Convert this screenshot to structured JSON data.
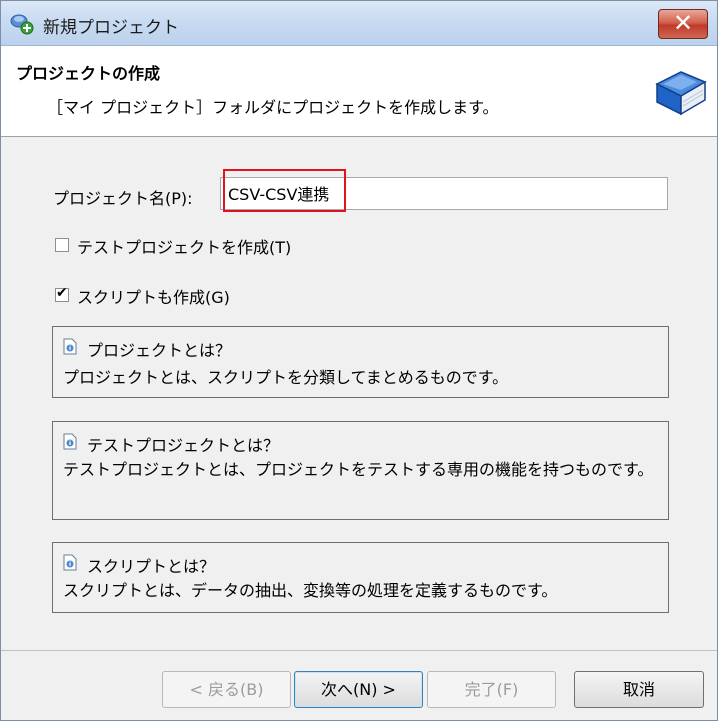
{
  "window": {
    "title": "新規プロジェクト",
    "close_glyph": "✕"
  },
  "header": {
    "title": "プロジェクトの作成",
    "description": "［マイ プロジェクト］フォルダにプロジェクトを作成します。",
    "icon": "book-icon",
    "icon_color": "#1f63c6"
  },
  "form": {
    "project_name_label": "プロジェクト名(P):",
    "project_name_value": "CSV-CSV連携",
    "highlight_color": "#e0141e",
    "test_project_checkbox": {
      "label": "テストプロジェクトを作成(T)",
      "checked": false
    },
    "script_checkbox": {
      "label": "スクリプトも作成(G)",
      "checked": true,
      "mark": "✔"
    }
  },
  "info_boxes": [
    {
      "title": "プロジェクトとは？",
      "body": "プロジェクトとは、スクリプトを分類してまとめるものです。"
    },
    {
      "title": "テストプロジェクトとは？",
      "body": "テストプロジェクトとは、プロジェクトをテストする専用の機能を持つものです。"
    },
    {
      "title": "スクリプトとは？",
      "body": "スクリプトとは、データの抽出、変換等の処理を定義するものです。"
    }
  ],
  "footer": {
    "back_label": "< 戻る(B)",
    "next_label": "次へ(N) >",
    "finish_label": "完了(F)",
    "cancel_label": "取消"
  }
}
